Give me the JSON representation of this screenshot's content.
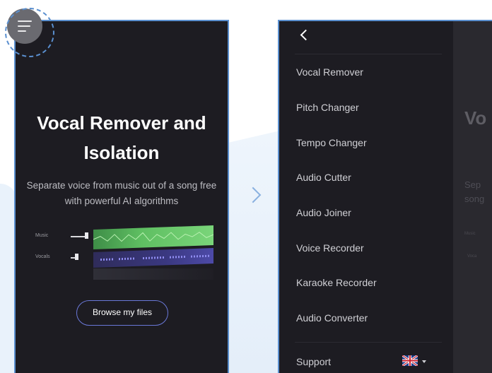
{
  "left_screen": {
    "title": "Vocal Remover and Isolation",
    "subtitle": "Separate voice from music out of a song free with powerful AI algorithms",
    "tracks": [
      {
        "label": "Music"
      },
      {
        "label": "Vocals"
      }
    ],
    "browse_button": "Browse my files"
  },
  "right_screen": {
    "menu_items": [
      "Vocal Remover",
      "Pitch Changer",
      "Tempo Changer",
      "Audio Cutter",
      "Audio Joiner",
      "Voice Recorder",
      "Karaoke Recorder",
      "Audio Converter"
    ],
    "support_label": "Support",
    "behind_title": "Vo",
    "behind_sub_1": "Sep",
    "behind_sub_2": "song",
    "behind_mini_1": "Music",
    "behind_mini_2": "Voca"
  },
  "colors": {
    "phone_bg": "#1d1c22",
    "frame_border": "#5a8fcf",
    "music_wave": "#5fbf62",
    "vocal_wave": "#3a3880",
    "button_border": "#6a78d8"
  }
}
